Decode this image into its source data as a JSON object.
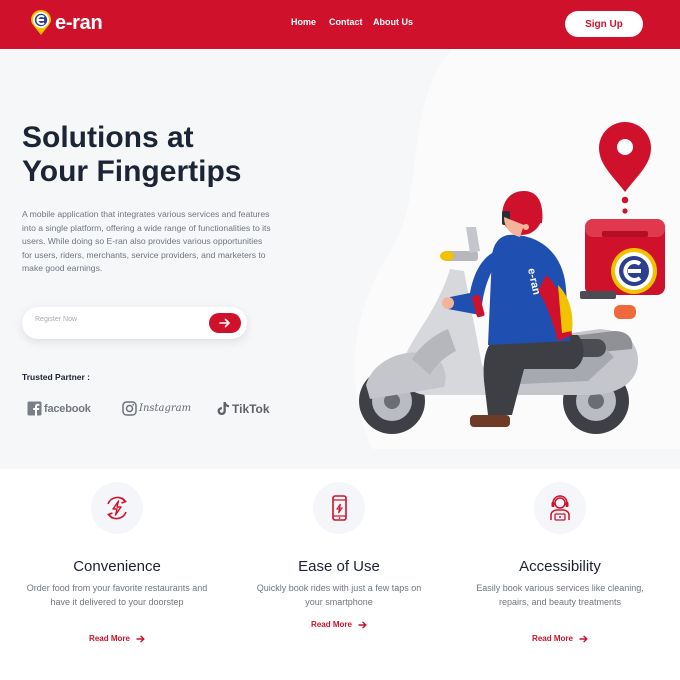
{
  "header": {
    "brand": "e-ran",
    "nav": [
      "Home",
      "Contact",
      "About Us"
    ],
    "signup_label": "Sign Up"
  },
  "hero": {
    "title_line1": "Solutions at",
    "title_line2": "Your Fingertips",
    "description": "A mobile application that integrates various services and features into a single platform, offering a wide range of functionalities to its users. While doing so E-ran also provides various opportunities for users, riders, merchants, service providers, and marketers to make good earnings.",
    "register_placeholder": "Register Now",
    "trusted_label": "Trusted Partner :",
    "partners": [
      "facebook",
      "Instagram",
      "TikTok"
    ],
    "rider_jacket_text": "e-ran"
  },
  "features": [
    {
      "icon": "lightning-refresh-icon",
      "title": "Convenience",
      "desc": "Order food from your favorite restaurants and have it delivered to your doorstep",
      "link": "Read More"
    },
    {
      "icon": "smartphone-icon",
      "title": "Ease of Use",
      "desc": "Quickly book rides with just a few taps on your smartphone",
      "link": "Read More"
    },
    {
      "icon": "support-agent-icon",
      "title": "Accessibility",
      "desc": "Easily book various services like cleaning, repairs, and beauty treatments",
      "link": "Read More"
    }
  ],
  "colors": {
    "brand_red": "#d0112b",
    "hero_bg": "#f6f7f9",
    "dark_text": "#1c2536"
  }
}
